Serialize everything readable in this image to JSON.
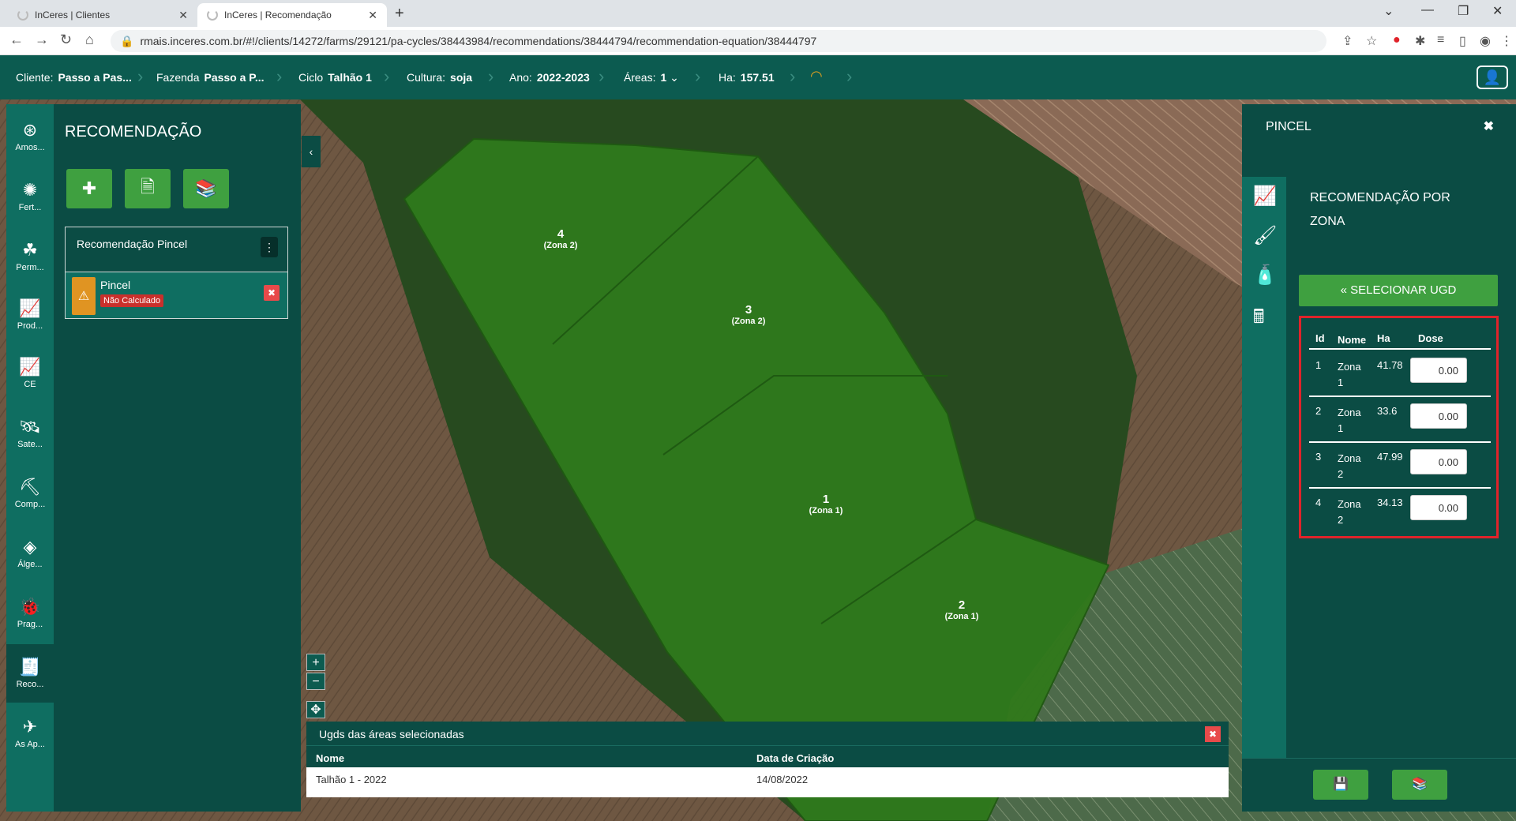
{
  "browser": {
    "tabs": [
      {
        "title": "InCeres | Clientes",
        "close": "✕"
      },
      {
        "title": "InCeres | Recomendação",
        "close": "✕"
      }
    ],
    "new_tab": "+",
    "url": "rmais.inceres.com.br/#!/clients/14272/farms/29121/pa-cycles/38443984/recommendations/38444794/recommendation-equation/38444797"
  },
  "header": {
    "cliente_label": "Cliente:",
    "cliente_value": "Passo a Pas...",
    "fazenda_label": "Fazenda",
    "fazenda_value": "Passo a P...",
    "ciclo_label": "Ciclo",
    "ciclo_value": "Talhão 1",
    "cultura_label": "Cultura:",
    "cultura_value": "soja",
    "ano_label": "Ano:",
    "ano_value": "2022-2023",
    "areas_label": "Áreas:",
    "areas_value": "1",
    "ha_label": "Ha:",
    "ha_value": "157.51"
  },
  "sidebar": {
    "items": [
      {
        "label": "Amos...",
        "icon": "sample-icon"
      },
      {
        "label": "Fert...",
        "icon": "fertility-icon"
      },
      {
        "label": "Perm...",
        "icon": "permission-icon"
      },
      {
        "label": "Prod...",
        "icon": "productivity-chart-icon"
      },
      {
        "label": "CE",
        "icon": "ce-chart-icon"
      },
      {
        "label": "Sate...",
        "icon": "satellite-icon"
      },
      {
        "label": "Comp...",
        "icon": "compaction-icon"
      },
      {
        "label": "Álge...",
        "icon": "layers-icon"
      },
      {
        "label": "Prag...",
        "icon": "bug-icon"
      },
      {
        "label": "Reco...",
        "icon": "recommendation-icon"
      },
      {
        "label": "As Ap...",
        "icon": "application-icon"
      }
    ]
  },
  "left_panel": {
    "title": "RECOMENDAÇÃO",
    "card_title": "Recomendação Pincel",
    "item_title": "Pincel",
    "item_status": "Não Calculado"
  },
  "map": {
    "zones": [
      {
        "number": "4",
        "label": "(Zona 2)"
      },
      {
        "number": "3",
        "label": "(Zona 2)"
      },
      {
        "number": "1",
        "label": "(Zona 1)"
      },
      {
        "number": "2",
        "label": "(Zona 1)"
      }
    ]
  },
  "ugd": {
    "title": "Ugds das áreas selecionadas",
    "col_name": "Nome",
    "col_date": "Data de Criação",
    "rows": [
      {
        "name": "Talhão 1 - 2022",
        "date": "14/08/2022"
      }
    ]
  },
  "right_panel": {
    "title": "PINCEL",
    "subtitle": "RECOMENDAÇÃO POR ZONA",
    "select_button": "« SELECIONAR UGD",
    "table_headers": {
      "id": "Id",
      "name": "Nome",
      "ha": "Ha",
      "dose": "Dose"
    },
    "rows": [
      {
        "id": "1",
        "name": "Zona 1",
        "ha": "41.78",
        "dose": "0.00"
      },
      {
        "id": "2",
        "name": "Zona 1",
        "ha": "33.6",
        "dose": "0.00"
      },
      {
        "id": "3",
        "name": "Zona 2",
        "ha": "47.99",
        "dose": "0.00"
      },
      {
        "id": "4",
        "name": "Zona 2",
        "ha": "34.13",
        "dose": "0.00"
      }
    ]
  },
  "colors": {
    "primary": "#0b4c44",
    "accent": "#3fa040",
    "danger": "#e84a4a",
    "warning": "#e09422",
    "field": "#2f7a1c"
  }
}
